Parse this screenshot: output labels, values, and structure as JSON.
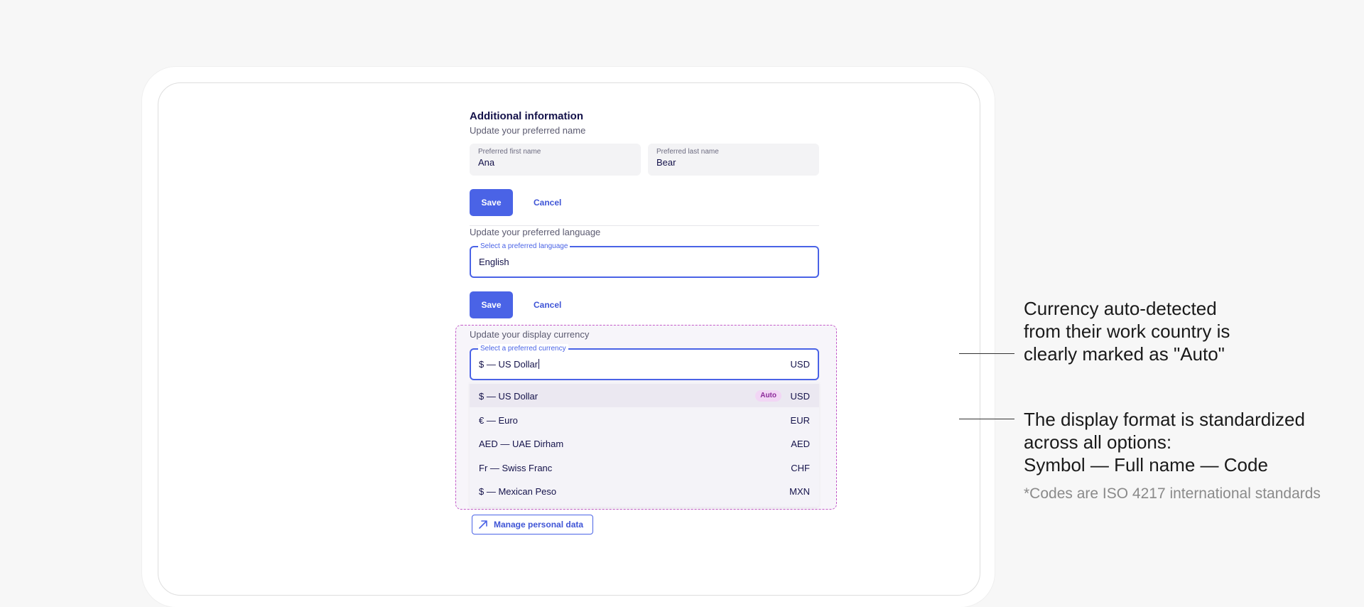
{
  "section": {
    "title": "Additional information",
    "name_subtitle": "Update your preferred name",
    "language_subtitle": "Update your preferred language",
    "currency_subtitle": "Update your display currency"
  },
  "name_fields": {
    "first": {
      "label": "Preferred first name",
      "value": "Ana"
    },
    "last": {
      "label": "Preferred last name",
      "value": "Bear"
    }
  },
  "actions": {
    "save_label": "Save",
    "cancel_label": "Cancel"
  },
  "language_field": {
    "label": "Select a preferred language",
    "value": "English"
  },
  "currency_field": {
    "label": "Select a preferred currency",
    "value": "$ — US Dollar",
    "code": "USD"
  },
  "currency_options": [
    {
      "name": "$ — US Dollar",
      "code": "USD",
      "badge": "Auto",
      "highlighted": true
    },
    {
      "name": "€ — Euro",
      "code": "EUR"
    },
    {
      "name": "AED — UAE Dirham",
      "code": "AED"
    },
    {
      "name": "Fr — Swiss Franc",
      "code": "CHF"
    },
    {
      "name": "$ — Mexican Peso",
      "code": "MXN"
    }
  ],
  "manage_button": {
    "label": "Manage personal data",
    "icon": "arrow-up-right-icon"
  },
  "annotations": {
    "auto": [
      "Currency auto-detected",
      "from their work country is",
      "clearly marked as \"Auto\""
    ],
    "format": [
      "The display format is standardized",
      "across all options:",
      "Symbol — Full name — Code"
    ],
    "note": "*Codes are ISO 4217 international standards"
  },
  "colors": {
    "primary": "#4a63e6",
    "auto_badge_bg": "#f2d6f5",
    "auto_badge_text": "#8d2a9a",
    "highlight_border": "#c35ac8"
  }
}
